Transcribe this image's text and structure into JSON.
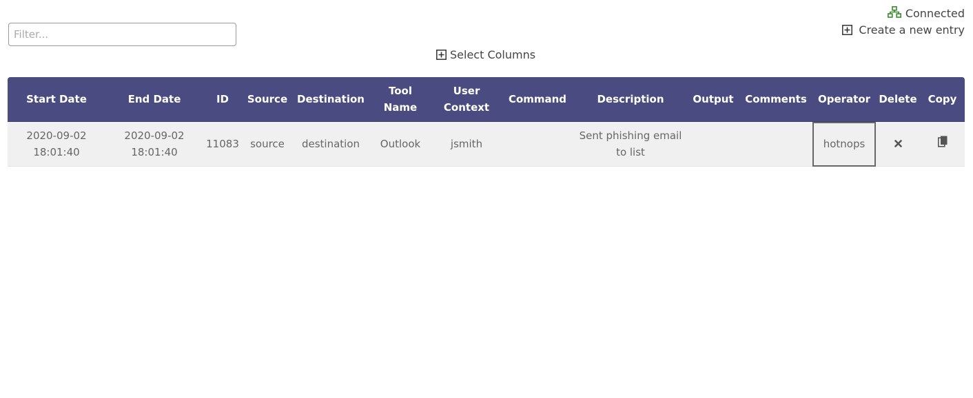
{
  "toolbar": {
    "filter_placeholder": "Filter...",
    "status_label": "Connected",
    "status_color": "#3a8a2e",
    "create_entry_label": "Create a new entry",
    "select_columns_label": "Select Columns"
  },
  "icons": {
    "status": "network-icon",
    "create": "plus-square-icon",
    "select_columns": "plus-square-icon",
    "delete": "close-icon",
    "copy": "copy-icon"
  },
  "colors": {
    "header_bg": "#4a4b80",
    "row_bg": "#f0f0f0"
  },
  "table": {
    "columns": [
      "Start Date",
      "End Date",
      "ID",
      "Source",
      "Destination",
      "Tool Name",
      "User Context",
      "Command",
      "Description",
      "Output",
      "Comments",
      "Operator",
      "Delete",
      "Copy"
    ],
    "rows": [
      {
        "start_date": "2020-09-02 18:01:40",
        "end_date": "2020-09-02 18:01:40",
        "id": "11083",
        "source": "source",
        "destination": "destination",
        "tool_name": "Outlook",
        "user_context": "jsmith",
        "command": "",
        "description": "Sent phishing email to list",
        "output": "",
        "comments": "",
        "operator": "hotnops"
      }
    ]
  }
}
